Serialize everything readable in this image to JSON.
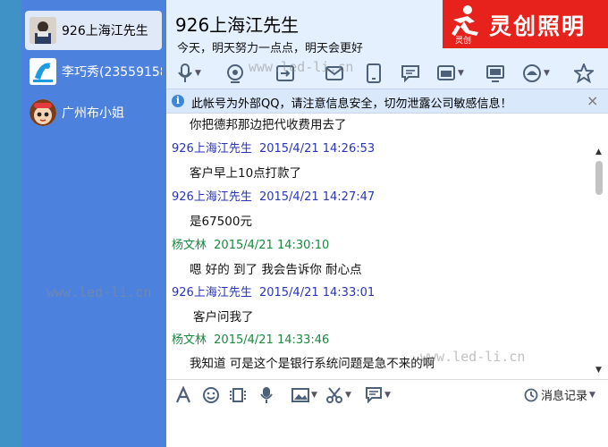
{
  "sidebar": {
    "contacts": [
      {
        "name": "926上海江先生",
        "active": true
      },
      {
        "name": "李巧秀(23559158",
        "active": false
      },
      {
        "name": "广州布小姐",
        "active": false
      }
    ]
  },
  "header": {
    "title": "926上海江先生",
    "signature": "今天，明天努力一点点，明天会更好"
  },
  "logo": {
    "text": "灵创照明",
    "mark_text": "灵创"
  },
  "notice": {
    "text": "此帐号为外部QQ，请注意信息安全，切勿泄露公司敏感信息！",
    "close": "×"
  },
  "messages": [
    {
      "sender": "",
      "time": "",
      "text": "你把德邦那边把代收费用去了",
      "color": "#111111"
    },
    {
      "sender": "926上海江先生",
      "time": "2015/4/21 14:26:53",
      "text": "客户早上10点打款了",
      "color": "#2a35b5"
    },
    {
      "sender": "926上海江先生",
      "time": "2015/4/21 14:27:47",
      "text": "是67500元",
      "color": "#2a35b5"
    },
    {
      "sender": "杨文林",
      "time": "2015/4/21 14:30:10",
      "text": "嗯 好的 到了 我会告诉你  耐心点",
      "color": "#178a3e"
    },
    {
      "sender": "926上海江先生",
      "time": "2015/4/21 14:33:01",
      "text": "客户问我了",
      "color": "#2a35b5"
    },
    {
      "sender": "杨文林",
      "time": "2015/4/21 14:33:46",
      "text": "我知道  可是这个是银行系统问题是急不来的啊",
      "color": "#178a3e"
    }
  ],
  "input_toolbar": {
    "history_label": "消息记录"
  },
  "watermarks": [
    "www.led-li.cn",
    "www.led-li.cn",
    "www.led-li.cn"
  ],
  "colors": {
    "sidebar": "#4c82dd",
    "header": "#e5f0ff",
    "notice": "#d9e8fb",
    "logo": "#e7211c",
    "contact_sender": "#2a35b5",
    "self_sender": "#178a3e"
  }
}
